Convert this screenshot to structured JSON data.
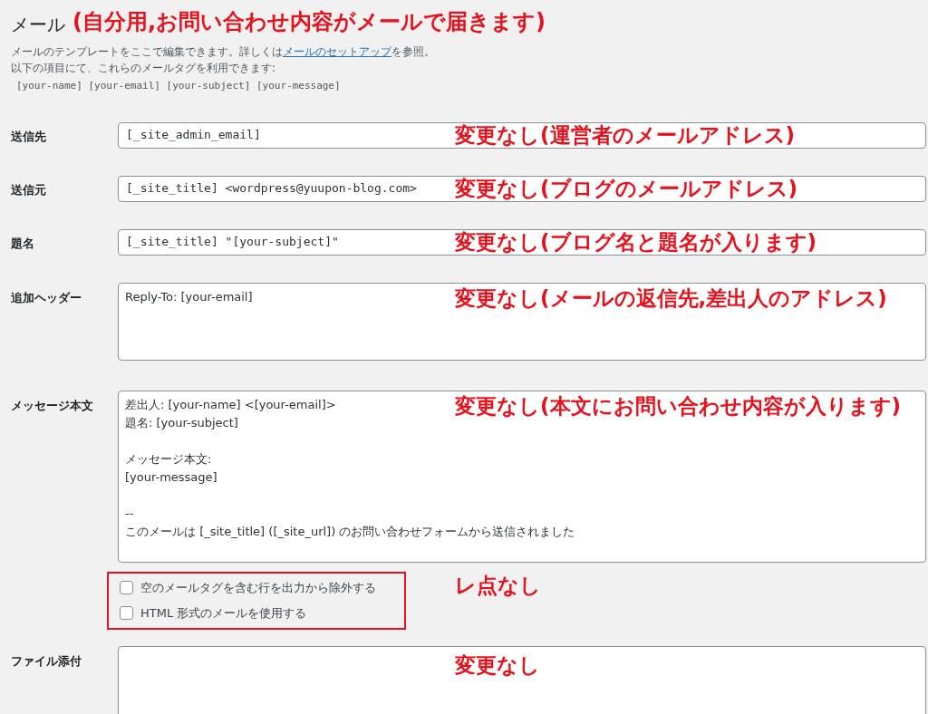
{
  "heading": {
    "title": "メール",
    "note": "(自分用,お問い合わせ内容がメールで届きます)"
  },
  "description": {
    "before": "メールのテンプレートをここで編集できます。詳しくは",
    "link": "メールのセットアップ",
    "after": "を参照。"
  },
  "tags_intro": "以下の項目にて、これらのメールタグを利用できます:",
  "tags": "[your-name] [your-email] [your-subject] [your-message]",
  "fields": [
    {
      "kind": "input",
      "label": "送信先",
      "lines": [
        "[_site_admin_email]"
      ],
      "annotation": "変更なし(運営者のメールアドレス)"
    },
    {
      "kind": "input",
      "label": "送信元",
      "lines": [
        "[_site_title] <wordpress@yuupon-blog.com>"
      ],
      "annotation": "変更なし(ブログのメールアドレス)"
    },
    {
      "kind": "input",
      "label": "題名",
      "lines": [
        "[_site_title] \"[your-subject]\""
      ],
      "annotation": "変更なし(ブログ名と題名が入ります)"
    },
    {
      "kind": "textarea",
      "label": "追加ヘッダー",
      "lines": [
        "Reply-To: [your-email]"
      ],
      "annotation": "変更なし(メールの返信先,差出人のアドレス)"
    },
    {
      "kind": "textarea",
      "label": "メッセージ本文",
      "lines": [
        "差出人: [your-name] <[your-email]>",
        "題名: [your-subject]"
      ],
      "paragraphs": [
        [
          "メッセージ本文:",
          "[your-message]"
        ],
        [
          "--",
          "このメールは [_site_title] ([_site_url]) のお問い合わせフォームから送信されました"
        ]
      ],
      "annotation": "変更なし(本文にお問い合わせ内容が入ります)"
    }
  ],
  "options": {
    "annotation": "レ点なし",
    "items": [
      {
        "label": "空のメールタグを含む行を出力から除外する",
        "checked": false
      },
      {
        "label": "HTML 形式のメールを使用する",
        "checked": false
      }
    ]
  },
  "attachments": {
    "label": "ファイル添付",
    "annotation": "変更なし"
  }
}
